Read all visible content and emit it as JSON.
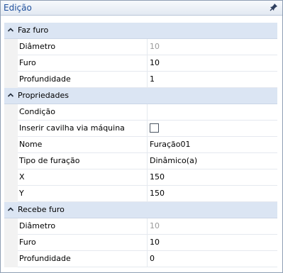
{
  "window": {
    "title": "Edição",
    "pin_icon": "pin-icon"
  },
  "sections": [
    {
      "label": "Faz furo",
      "rows": [
        {
          "name": "Diâmetro",
          "value": "10",
          "disabled": true
        },
        {
          "name": "Furo",
          "value": "10"
        },
        {
          "name": "Profundidade",
          "value": "1"
        }
      ]
    },
    {
      "label": "Propriedades",
      "rows": [
        {
          "name": "Condição",
          "value": ""
        },
        {
          "name": "Inserir cavilha via máquina",
          "checked": false
        },
        {
          "name": "Nome",
          "value": "Furação01"
        },
        {
          "name": "Tipo de furação",
          "value": "Dinâmico(a)"
        },
        {
          "name": "X",
          "value": "150"
        },
        {
          "name": "Y",
          "value": "150"
        }
      ]
    },
    {
      "label": "Recebe furo",
      "rows": [
        {
          "name": "Diâmetro",
          "value": "10",
          "disabled": true
        },
        {
          "name": "Furo",
          "value": "10"
        },
        {
          "name": "Profundidade",
          "value": "0"
        }
      ]
    }
  ]
}
